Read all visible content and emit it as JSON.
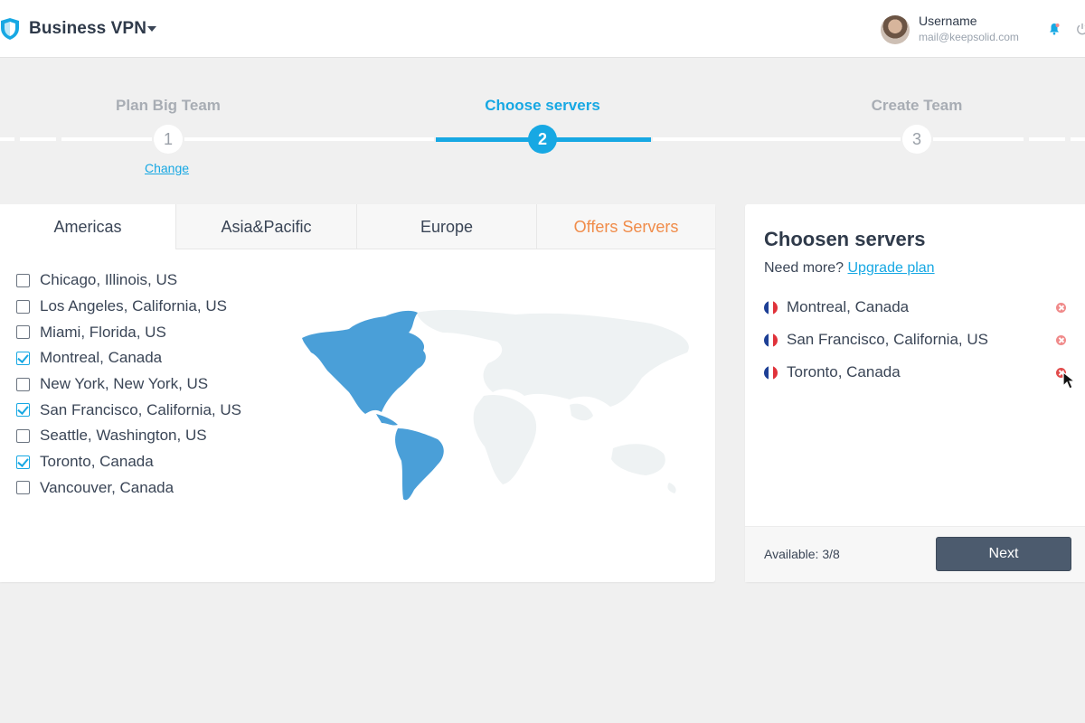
{
  "header": {
    "brand": "Business VPN",
    "user_name": "Username",
    "user_email": "mail@keepsolid.com",
    "icons": [
      "shield-logo-icon",
      "chevron-down-icon",
      "bell-icon",
      "power-icon"
    ]
  },
  "stepper": {
    "steps": [
      {
        "number": "1",
        "label": "Plan Big Team",
        "state": "completed",
        "link": "Change"
      },
      {
        "number": "2",
        "label": "Choose servers",
        "state": "active"
      },
      {
        "number": "3",
        "label": "Create Team",
        "state": "upcoming"
      }
    ]
  },
  "regions": {
    "tabs": [
      {
        "label": "Americas",
        "active": true
      },
      {
        "label": "Asia&Pacific",
        "active": false
      },
      {
        "label": "Europe",
        "active": false
      },
      {
        "label": "Offers Servers",
        "active": false
      }
    ],
    "servers": [
      {
        "label": "Chicago, Illinois, US",
        "checked": false
      },
      {
        "label": "Los Angeles, California, US",
        "checked": false
      },
      {
        "label": "Miami, Florida, US",
        "checked": false
      },
      {
        "label": "Montreal, Canada",
        "checked": true
      },
      {
        "label": "New York, New York, US",
        "checked": false
      },
      {
        "label": "San Francisco, California, US",
        "checked": true
      },
      {
        "label": "Seattle, Washington, US",
        "checked": false
      },
      {
        "label": "Toronto, Canada",
        "checked": true
      },
      {
        "label": "Vancouver, Canada",
        "checked": false
      }
    ]
  },
  "chosen": {
    "title": "Choosen servers",
    "need_more": "Need more?",
    "upgrade_link": "Upgrade plan",
    "servers": [
      {
        "label": "Montreal, Canada"
      },
      {
        "label": "San Francisco, California, US"
      },
      {
        "label": "Toronto, Canada"
      }
    ],
    "available": "Available: 3/8",
    "next_label": "Next"
  },
  "colors": {
    "accent": "#17a8e3",
    "offers": "#f08c4a",
    "button": "#4c5b6e",
    "remove": "#f08a8a",
    "map_highlight": "#4a9fd8",
    "map_muted": "#eef2f3"
  }
}
